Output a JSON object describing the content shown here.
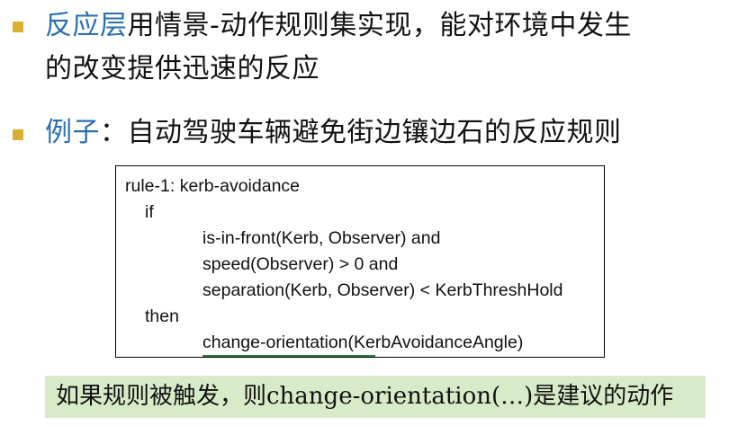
{
  "bullets": [
    {
      "highlight": "反应层",
      "line1_rest": "用情景-动作规则集实现，能对环境中发生",
      "line2": "的改变提供迅速的反应"
    },
    {
      "highlight": "例子",
      "rest": "：自动驾驶车辆避免街边镶边石的反应规则"
    }
  ],
  "rule": {
    "header": "rule-1: kerb-avoidance",
    "if_kw": "if",
    "conditions": [
      "is-in-front(Kerb, Observer) and",
      "speed(Observer) > 0 and",
      "separation(Kerb, Observer) < KerbThreshHold"
    ],
    "then_kw": "then",
    "action_name": "change-orientation",
    "action_args": "(KerbAvoidanceAngle)"
  },
  "note": "如果规则被触发，则change-orientation(…)是建议的动作",
  "colors": {
    "highlight": "#2a6fb0",
    "bullet": "#d9b02f",
    "note_bg": "#d8ebc8",
    "underline": "#2f7d3a"
  }
}
